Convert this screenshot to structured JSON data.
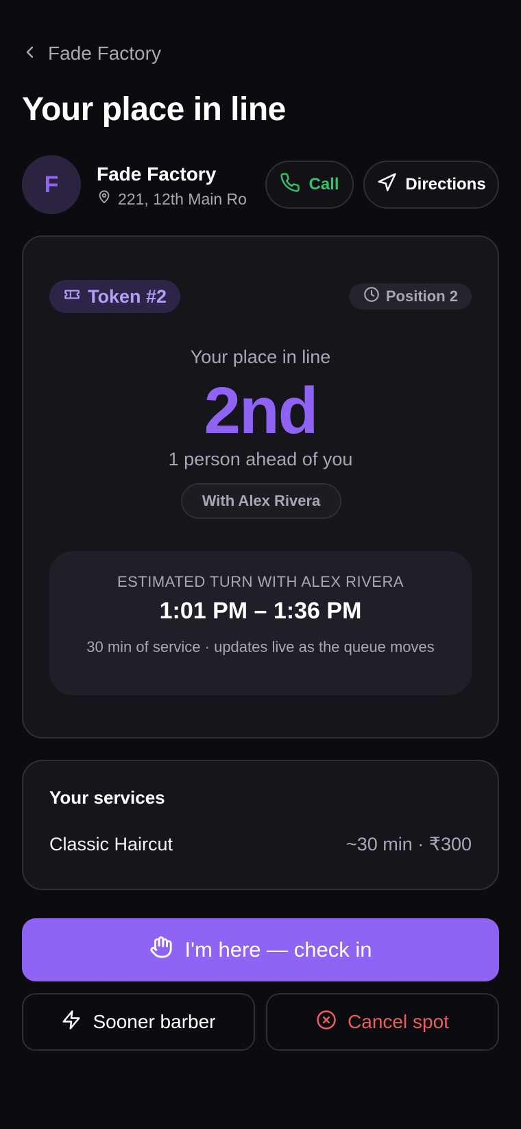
{
  "nav": {
    "back_label": "Fade Factory"
  },
  "page": {
    "title": "Your place in line"
  },
  "shop": {
    "avatar_letter": "F",
    "name": "Fade Factory",
    "address": "221, 12th Main Ro",
    "call_label": "Call",
    "directions_label": "Directions"
  },
  "queue": {
    "token_label": "Token #2",
    "position_label": "Position 2",
    "place_label": "Your place in line",
    "place_value": "2nd",
    "ahead_text": "1 person ahead of you",
    "barber_chip": "With Alex Rivera",
    "estimate": {
      "label": "ESTIMATED TURN WITH ALEX RIVERA",
      "time_range": "1:01 PM – 1:36 PM",
      "note": "30 min of service · updates live as the queue moves"
    }
  },
  "services": {
    "title": "Your services",
    "items": [
      {
        "name": "Classic Haircut",
        "meta": "~30 min · ₹300"
      }
    ]
  },
  "actions": {
    "checkin_label": "I'm here — check in",
    "sooner_label": "Sooner barber",
    "cancel_label": "Cancel spot"
  },
  "icons": {
    "back": "chevron-left-icon",
    "location": "map-pin-icon",
    "call": "phone-icon",
    "directions": "navigation-arrow-icon",
    "token": "ticket-icon",
    "position": "clock-icon",
    "checkin": "hand-icon",
    "sooner": "lightning-icon",
    "cancel": "x-circle-icon"
  },
  "colors": {
    "background": "#0c0c10",
    "card": "#15151b",
    "accent": "#8f63f3",
    "call_green": "#34c16e",
    "cancel_red": "#e5605f",
    "muted_text": "#a8a8b3"
  }
}
